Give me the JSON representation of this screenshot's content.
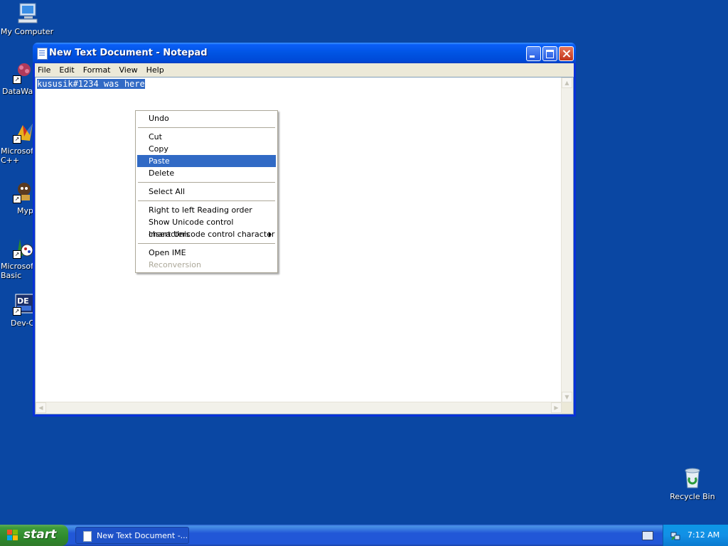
{
  "desktop": {
    "icons": [
      {
        "label": "My Computer",
        "icon": "my-computer-icon"
      },
      {
        "label": "DataWa",
        "icon": "datawa-icon"
      },
      {
        "label": "Microsoft C++",
        "icon": "visual-cpp-icon"
      },
      {
        "label": "Myp",
        "icon": "myp-icon"
      },
      {
        "label": "Microsoft Basic",
        "icon": "visual-basic-icon"
      },
      {
        "label": "Dev-C",
        "icon": "dev-cpp-icon"
      },
      {
        "label": "Recycle Bin",
        "icon": "recycle-bin-icon"
      }
    ]
  },
  "window": {
    "title": "New Text Document - Notepad",
    "menu": [
      "File",
      "Edit",
      "Format",
      "View",
      "Help"
    ],
    "content": "kususik#1234 was here"
  },
  "context_menu": {
    "items": [
      {
        "label": "Undo",
        "state": "normal"
      },
      {
        "label": "Cut",
        "state": "normal"
      },
      {
        "label": "Copy",
        "state": "normal"
      },
      {
        "label": "Paste",
        "state": "highlighted"
      },
      {
        "label": "Delete",
        "state": "normal"
      },
      {
        "label": "Select All",
        "state": "normal"
      },
      {
        "label": "Right to left Reading order",
        "state": "normal"
      },
      {
        "label": "Show Unicode control characters",
        "state": "normal"
      },
      {
        "label": "Insert Unicode control character",
        "state": "submenu"
      },
      {
        "label": "Open IME",
        "state": "normal"
      },
      {
        "label": "Reconversion",
        "state": "disabled"
      }
    ]
  },
  "taskbar": {
    "start_label": "start",
    "task_label": "New Text Document -...",
    "clock": "7:12 AM"
  },
  "colors": {
    "desktop_bg": "#0a47a3",
    "selection": "#316ac5",
    "start_green": "#3c9b3a"
  }
}
